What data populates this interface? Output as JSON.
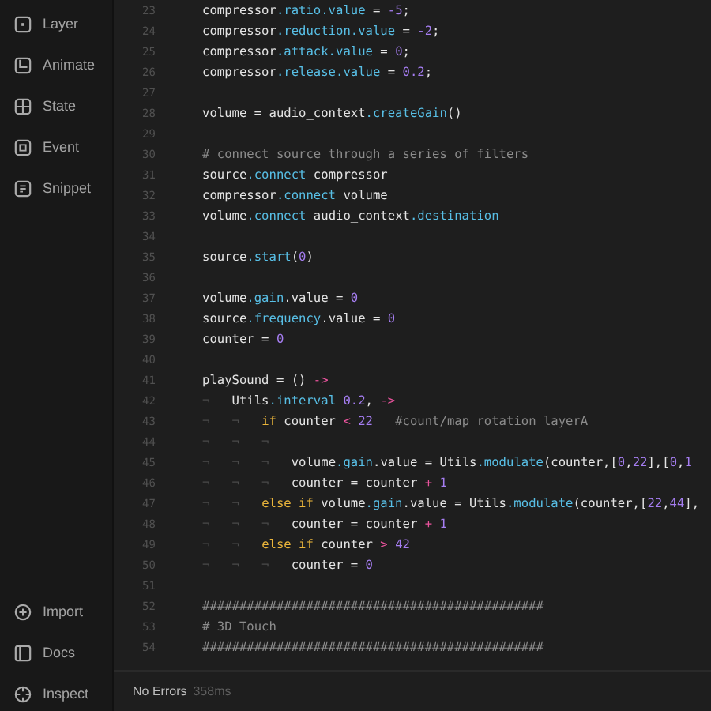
{
  "sidebar": {
    "top_items": [
      {
        "label": "Layer"
      },
      {
        "label": "Animate"
      },
      {
        "label": "State"
      },
      {
        "label": "Event"
      },
      {
        "label": "Snippet"
      }
    ],
    "bottom_items": [
      {
        "label": "Import"
      },
      {
        "label": "Docs"
      },
      {
        "label": "Inspect"
      }
    ]
  },
  "editor": {
    "lines": [
      {
        "number": "23",
        "tokens": [
          {
            "text": "compressor",
            "kind": "plain"
          },
          {
            "text": ".ratio.value",
            "kind": "prop"
          },
          {
            "text": " = ",
            "kind": "plain"
          },
          {
            "text": "-5",
            "kind": "num"
          },
          {
            "text": ";",
            "kind": "plain"
          }
        ]
      },
      {
        "number": "24",
        "tokens": [
          {
            "text": "compressor",
            "kind": "plain"
          },
          {
            "text": ".reduction.value",
            "kind": "prop"
          },
          {
            "text": " = ",
            "kind": "plain"
          },
          {
            "text": "-2",
            "kind": "num"
          },
          {
            "text": ";",
            "kind": "plain"
          }
        ]
      },
      {
        "number": "25",
        "tokens": [
          {
            "text": "compressor",
            "kind": "plain"
          },
          {
            "text": ".attack.value",
            "kind": "prop"
          },
          {
            "text": " = ",
            "kind": "plain"
          },
          {
            "text": "0",
            "kind": "num"
          },
          {
            "text": ";",
            "kind": "plain"
          }
        ]
      },
      {
        "number": "26",
        "tokens": [
          {
            "text": "compressor",
            "kind": "plain"
          },
          {
            "text": ".release.value",
            "kind": "prop"
          },
          {
            "text": " = ",
            "kind": "plain"
          },
          {
            "text": "0.2",
            "kind": "num"
          },
          {
            "text": ";",
            "kind": "plain"
          }
        ]
      },
      {
        "number": "27"
      },
      {
        "number": "28",
        "tokens": [
          {
            "text": "volume = audio_context",
            "kind": "plain"
          },
          {
            "text": ".createGain",
            "kind": "prop"
          },
          {
            "text": "()",
            "kind": "plain"
          }
        ]
      },
      {
        "number": "29"
      },
      {
        "number": "30",
        "tokens": [
          {
            "text": "# connect source through a series of filters",
            "kind": "comment"
          }
        ]
      },
      {
        "number": "31",
        "tokens": [
          {
            "text": "source",
            "kind": "plain"
          },
          {
            "text": ".connect",
            "kind": "prop"
          },
          {
            "text": " compressor",
            "kind": "plain"
          }
        ]
      },
      {
        "number": "32",
        "tokens": [
          {
            "text": "compressor",
            "kind": "plain"
          },
          {
            "text": ".connect",
            "kind": "prop"
          },
          {
            "text": " volume",
            "kind": "plain"
          }
        ]
      },
      {
        "number": "33",
        "tokens": [
          {
            "text": "volume",
            "kind": "plain"
          },
          {
            "text": ".connect",
            "kind": "prop"
          },
          {
            "text": " audio_context",
            "kind": "plain"
          },
          {
            "text": ".destination",
            "kind": "prop"
          }
        ]
      },
      {
        "number": "34"
      },
      {
        "number": "35",
        "tokens": [
          {
            "text": "source",
            "kind": "plain"
          },
          {
            "text": ".start",
            "kind": "prop"
          },
          {
            "text": "(",
            "kind": "plain"
          },
          {
            "text": "0",
            "kind": "num"
          },
          {
            "text": ")",
            "kind": "plain"
          }
        ]
      },
      {
        "number": "36"
      },
      {
        "number": "37",
        "tokens": [
          {
            "text": "volume",
            "kind": "plain"
          },
          {
            "text": ".gain",
            "kind": "prop"
          },
          {
            "text": ".value = ",
            "kind": "plain"
          },
          {
            "text": "0",
            "kind": "num"
          }
        ]
      },
      {
        "number": "38",
        "tokens": [
          {
            "text": "source",
            "kind": "plain"
          },
          {
            "text": ".frequency",
            "kind": "prop"
          },
          {
            "text": ".value = ",
            "kind": "plain"
          },
          {
            "text": "0",
            "kind": "num"
          }
        ]
      },
      {
        "number": "39",
        "tokens": [
          {
            "text": "counter = ",
            "kind": "plain"
          },
          {
            "text": "0",
            "kind": "num"
          }
        ]
      },
      {
        "number": "40"
      },
      {
        "number": "41",
        "tokens": [
          {
            "text": "playSound = () ",
            "kind": "plain"
          },
          {
            "text": "->",
            "kind": "op"
          }
        ]
      },
      {
        "number": "42",
        "tokens": [
          {
            "text": "¬   ",
            "kind": "guide"
          },
          {
            "text": "Utils",
            "kind": "plain"
          },
          {
            "text": ".interval",
            "kind": "prop"
          },
          {
            "text": " 0.2",
            "kind": "num"
          },
          {
            "text": ", ",
            "kind": "plain"
          },
          {
            "text": "->",
            "kind": "op"
          }
        ]
      },
      {
        "number": "43",
        "tokens": [
          {
            "text": "¬   ¬   ",
            "kind": "guide"
          },
          {
            "text": "if",
            "kind": "kw"
          },
          {
            "text": " counter ",
            "kind": "plain"
          },
          {
            "text": "<",
            "kind": "op"
          },
          {
            "text": " 22",
            "kind": "num"
          },
          {
            "text": "   #count/map rotation layerA",
            "kind": "comment"
          }
        ]
      },
      {
        "number": "44",
        "tokens": [
          {
            "text": "¬   ¬   ¬",
            "kind": "guide"
          }
        ]
      },
      {
        "number": "45",
        "tokens": [
          {
            "text": "¬   ¬   ¬   ",
            "kind": "guide"
          },
          {
            "text": "volume",
            "kind": "plain"
          },
          {
            "text": ".gain",
            "kind": "prop"
          },
          {
            "text": ".value = Utils",
            "kind": "plain"
          },
          {
            "text": ".modulate",
            "kind": "prop"
          },
          {
            "text": "(counter,[",
            "kind": "plain"
          },
          {
            "text": "0",
            "kind": "num"
          },
          {
            "text": ",",
            "kind": "plain"
          },
          {
            "text": "22",
            "kind": "num"
          },
          {
            "text": "],[",
            "kind": "plain"
          },
          {
            "text": "0",
            "kind": "num"
          },
          {
            "text": ",",
            "kind": "plain"
          },
          {
            "text": "1",
            "kind": "num"
          }
        ]
      },
      {
        "number": "46",
        "tokens": [
          {
            "text": "¬   ¬   ¬   ",
            "kind": "guide"
          },
          {
            "text": "counter = counter ",
            "kind": "plain"
          },
          {
            "text": "+",
            "kind": "op"
          },
          {
            "text": " 1",
            "kind": "num"
          }
        ]
      },
      {
        "number": "47",
        "tokens": [
          {
            "text": "¬   ¬   ",
            "kind": "guide"
          },
          {
            "text": "else if",
            "kind": "kw"
          },
          {
            "text": " volume",
            "kind": "plain"
          },
          {
            "text": ".gain",
            "kind": "prop"
          },
          {
            "text": ".value = Utils",
            "kind": "plain"
          },
          {
            "text": ".modulate",
            "kind": "prop"
          },
          {
            "text": "(counter,[",
            "kind": "plain"
          },
          {
            "text": "22",
            "kind": "num"
          },
          {
            "text": ",",
            "kind": "plain"
          },
          {
            "text": "44",
            "kind": "num"
          },
          {
            "text": "],",
            "kind": "plain"
          }
        ]
      },
      {
        "number": "48",
        "tokens": [
          {
            "text": "¬   ¬   ¬   ",
            "kind": "guide"
          },
          {
            "text": "counter = counter ",
            "kind": "plain"
          },
          {
            "text": "+",
            "kind": "op"
          },
          {
            "text": " 1",
            "kind": "num"
          }
        ]
      },
      {
        "number": "49",
        "tokens": [
          {
            "text": "¬   ¬   ",
            "kind": "guide"
          },
          {
            "text": "else if",
            "kind": "kw"
          },
          {
            "text": " counter ",
            "kind": "plain"
          },
          {
            "text": ">",
            "kind": "op"
          },
          {
            "text": " 42",
            "kind": "num"
          }
        ]
      },
      {
        "number": "50",
        "tokens": [
          {
            "text": "¬   ¬   ¬   ",
            "kind": "guide"
          },
          {
            "text": "counter = ",
            "kind": "plain"
          },
          {
            "text": "0",
            "kind": "num"
          }
        ]
      },
      {
        "number": "51"
      },
      {
        "number": "52",
        "tokens": [
          {
            "text": "##############################################",
            "kind": "comment"
          }
        ]
      },
      {
        "number": "53",
        "tokens": [
          {
            "text": "# 3D Touch",
            "kind": "comment"
          }
        ]
      },
      {
        "number": "54",
        "tokens": [
          {
            "text": "##############################################",
            "kind": "comment"
          }
        ]
      }
    ]
  },
  "status_bar": {
    "message": "No Errors",
    "timing": "358ms"
  }
}
